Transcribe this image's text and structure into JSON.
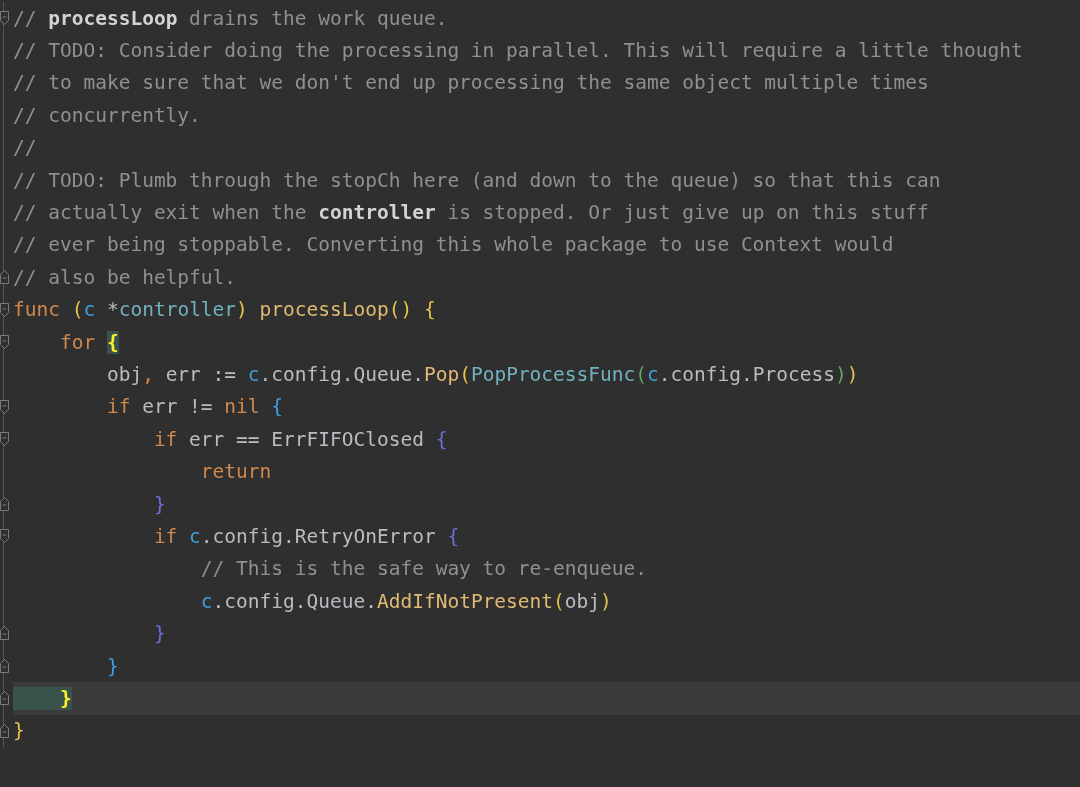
{
  "editor": {
    "lines": [
      {
        "fold_start": true,
        "fold_end": false,
        "current": false,
        "tokens": [
          {
            "text": "// **processLoop** drains the work queue.",
            "kind": "comment"
          }
        ]
      },
      {
        "fold_start": false,
        "fold_end": false,
        "current": false,
        "tokens": [
          {
            "text": "// TODO: Consider doing the processing in parallel. This will require a little thought",
            "kind": "comment"
          }
        ]
      },
      {
        "fold_start": false,
        "fold_end": false,
        "current": false,
        "tokens": [
          {
            "text": "// to make sure that we don't end up processing the same object multiple times",
            "kind": "comment"
          }
        ]
      },
      {
        "fold_start": false,
        "fold_end": false,
        "current": false,
        "tokens": [
          {
            "text": "// concurrently.",
            "kind": "comment"
          }
        ]
      },
      {
        "fold_start": false,
        "fold_end": false,
        "current": false,
        "tokens": [
          {
            "text": "//",
            "kind": "comment"
          }
        ]
      },
      {
        "fold_start": false,
        "fold_end": false,
        "current": false,
        "tokens": [
          {
            "text": "// TODO: Plumb through the stopCh here (and down to the queue) so that this can",
            "kind": "comment"
          }
        ]
      },
      {
        "fold_start": false,
        "fold_end": false,
        "current": false,
        "tokens": [
          {
            "text": "// actually exit when the **controller** is stopped. Or just give up on this stuff",
            "kind": "comment"
          }
        ]
      },
      {
        "fold_start": false,
        "fold_end": false,
        "current": false,
        "tokens": [
          {
            "text": "// ever being stoppable. Converting this whole package to use Context would",
            "kind": "comment"
          }
        ]
      },
      {
        "fold_start": false,
        "fold_end": true,
        "current": false,
        "tokens": [
          {
            "text": "// also be helpful.",
            "kind": "comment"
          }
        ]
      },
      {
        "fold_start": true,
        "fold_end": false,
        "current": false,
        "tokens": [
          {
            "text": "func ",
            "kind": "keyword"
          },
          {
            "text": "(",
            "kind": "bracket",
            "color": "#e6c24a"
          },
          {
            "text": "c",
            "kind": "param"
          },
          {
            "text": " *",
            "kind": "ident"
          },
          {
            "text": "controller",
            "kind": "type"
          },
          {
            "text": ") ",
            "kind": "bracket",
            "color": "#e6c24a"
          },
          {
            "text": "processLoop",
            "kind": "func"
          },
          {
            "text": "() {",
            "kind": "bracket",
            "color": "#e6c24a"
          }
        ]
      },
      {
        "fold_start": true,
        "fold_end": false,
        "current": false,
        "tokens": [
          {
            "text": "    for ",
            "kind": "keyword"
          },
          {
            "text": "{",
            "kind": "bracket",
            "matched": true
          }
        ]
      },
      {
        "fold_start": false,
        "fold_end": false,
        "current": false,
        "tokens": [
          {
            "text": "        obj",
            "kind": "ident"
          },
          {
            "text": ",",
            "kind": "keyword"
          },
          {
            "text": " err := ",
            "kind": "ident"
          },
          {
            "text": "c",
            "kind": "param"
          },
          {
            "text": ".config.Queue.",
            "kind": "ident"
          },
          {
            "text": "Pop",
            "kind": "func"
          },
          {
            "text": "(",
            "kind": "bracket",
            "color": "#e6c24a"
          },
          {
            "text": "PopProcessFunc",
            "kind": "type"
          },
          {
            "text": "(",
            "kind": "bracket",
            "color": "#5daa5d"
          },
          {
            "text": "c",
            "kind": "param"
          },
          {
            "text": ".config.Process",
            "kind": "ident"
          },
          {
            "text": ")",
            "kind": "bracket",
            "color": "#5daa5d"
          },
          {
            "text": ")",
            "kind": "bracket",
            "color": "#e6c24a"
          }
        ]
      },
      {
        "fold_start": true,
        "fold_end": false,
        "current": false,
        "tokens": [
          {
            "text": "        if",
            "kind": "keyword"
          },
          {
            "text": " err != ",
            "kind": "ident"
          },
          {
            "text": "nil ",
            "kind": "keyword"
          },
          {
            "text": "{",
            "kind": "bracket",
            "color": "#3e9fe6"
          }
        ]
      },
      {
        "fold_start": true,
        "fold_end": false,
        "current": false,
        "tokens": [
          {
            "text": "            if",
            "kind": "keyword"
          },
          {
            "text": " err == ErrFIFOClosed ",
            "kind": "ident"
          },
          {
            "text": "{",
            "kind": "bracket",
            "color": "#6b6fd8"
          }
        ]
      },
      {
        "fold_start": false,
        "fold_end": false,
        "current": false,
        "tokens": [
          {
            "text": "                return",
            "kind": "keyword"
          }
        ]
      },
      {
        "fold_start": false,
        "fold_end": true,
        "current": false,
        "tokens": [
          {
            "text": "            }",
            "kind": "bracket",
            "color": "#6b6fd8"
          }
        ]
      },
      {
        "fold_start": true,
        "fold_end": false,
        "current": false,
        "tokens": [
          {
            "text": "            if ",
            "kind": "keyword"
          },
          {
            "text": "c",
            "kind": "param"
          },
          {
            "text": ".config.RetryOnError ",
            "kind": "ident"
          },
          {
            "text": "{",
            "kind": "bracket",
            "color": "#6b6fd8"
          }
        ]
      },
      {
        "fold_start": false,
        "fold_end": false,
        "current": false,
        "tokens": [
          {
            "text": "                // This is the safe way to re-enqueue.",
            "kind": "comment"
          }
        ]
      },
      {
        "fold_start": false,
        "fold_end": false,
        "current": false,
        "tokens": [
          {
            "text": "                c",
            "kind": "param"
          },
          {
            "text": ".config.Queue.",
            "kind": "ident"
          },
          {
            "text": "AddIfNotPresent",
            "kind": "func"
          },
          {
            "text": "(",
            "kind": "bracket",
            "color": "#e6c24a"
          },
          {
            "text": "obj",
            "kind": "ident"
          },
          {
            "text": ")",
            "kind": "bracket",
            "color": "#e6c24a"
          }
        ]
      },
      {
        "fold_start": false,
        "fold_end": true,
        "current": false,
        "tokens": [
          {
            "text": "            }",
            "kind": "bracket",
            "color": "#6b6fd8"
          }
        ]
      },
      {
        "fold_start": false,
        "fold_end": true,
        "current": false,
        "tokens": [
          {
            "text": "        }",
            "kind": "bracket",
            "color": "#3e9fe6"
          }
        ]
      },
      {
        "fold_start": false,
        "fold_end": true,
        "current": true,
        "tokens": [
          {
            "text": "    }",
            "kind": "bracket",
            "matched": true
          }
        ]
      },
      {
        "fold_start": false,
        "fold_end": true,
        "current": false,
        "tokens": [
          {
            "text": "}",
            "kind": "bracket",
            "color": "#e6c24a"
          }
        ]
      }
    ]
  }
}
